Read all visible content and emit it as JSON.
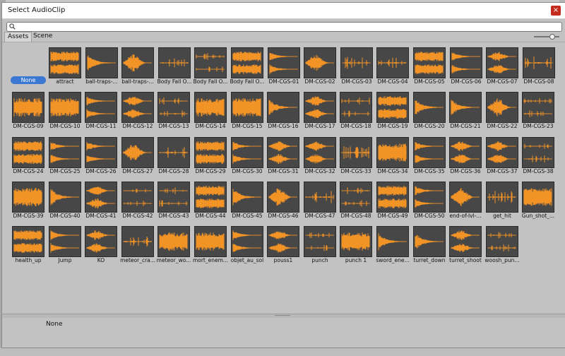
{
  "window": {
    "title": "Select AudioClip",
    "close_glyph": "×"
  },
  "search": {
    "value": "",
    "placeholder": ""
  },
  "tabs": [
    {
      "label": "Assets",
      "active": true
    },
    {
      "label": "Scene",
      "active": false
    }
  ],
  "none_item": {
    "label": "None"
  },
  "items": [
    "attract",
    "ball-traps-...",
    "ball-traps-...",
    "Body Fall O...",
    "Body Fall O...",
    "Body Fall O...",
    "DM-CGS-01",
    "DM-CGS-02",
    "DM-CGS-03",
    "DM-CGS-04",
    "DM-CGS-05",
    "DM-CGS-06",
    "DM-CGS-07",
    "DM-CGS-08",
    "DM-CGS-09",
    "DM-CGS-10",
    "DM-CGS-11",
    "DM-CGS-12",
    "DM-CGS-13",
    "DM-CGS-14",
    "DM-CGS-15",
    "DM-CGS-16",
    "DM-CGS-17",
    "DM-CGS-18",
    "DM-CGS-19",
    "DM-CGS-20",
    "DM-CGS-21",
    "DM-CGS-22",
    "DM-CGS-23",
    "DM-CGS-24",
    "DM-CGS-25",
    "DM-CGS-26",
    "DM-CGS-27",
    "DM-CGS-28",
    "DM-CGS-29",
    "DM-CGS-30",
    "DM-CGS-31",
    "DM-CGS-32",
    "DM-CGS-33",
    "DM-CGS-34",
    "DM-CGS-35",
    "DM-CGS-36",
    "DM-CGS-37",
    "DM-CGS-38",
    "DM-CGS-39",
    "DM-CGS-40",
    "DM-CGS-41",
    "DM-CGS-42",
    "DM-CGS-43",
    "DM-CGS-44",
    "DM-CGS-45",
    "DM-CGS-46",
    "DM-CGS-47",
    "DM-CGS-48",
    "DM-CGS-49",
    "DM-CGS-50",
    "end-of-lvl-...",
    "get_hit",
    "Gun_shot_...",
    "health_up",
    "Jump",
    "KO",
    "meteor_cra...",
    "meteor_wo...",
    "mort_enem...",
    "objet_au_sol",
    "pouss1",
    "punch",
    "punch 1",
    "sword_ene...",
    "turret_down",
    "turret_shoot",
    "woosh_pun..."
  ],
  "preview": {
    "selected_label": "None"
  },
  "colors": {
    "waveform": "#f29326",
    "thumb_bg": "#474747",
    "selected": "#3a78d4",
    "close": "#c42b1c"
  },
  "icons": {
    "search": "search-icon",
    "close": "close-icon"
  }
}
